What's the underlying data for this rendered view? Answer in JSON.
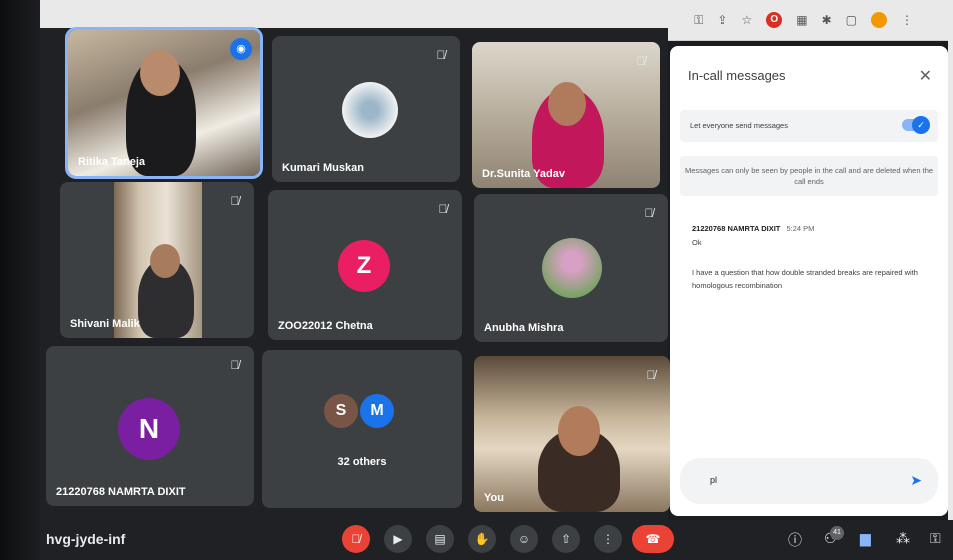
{
  "meeting_code": "hvg-jyde-inf",
  "participants": [
    {
      "name": "Ritika Taneja",
      "kind": "video",
      "speaking": true
    },
    {
      "name": "Kumari Muskan",
      "kind": "photo-avatar",
      "muted": true
    },
    {
      "name": "Dr.Sunita Yadav",
      "kind": "video",
      "muted": true
    },
    {
      "name": "Shivani Malik",
      "kind": "video",
      "muted": true
    },
    {
      "name": "ZOO22012 Chetna",
      "kind": "letter-avatar",
      "letter": "Z",
      "color": "#e91e63",
      "muted": true
    },
    {
      "name": "Anubha Mishra",
      "kind": "photo-avatar",
      "muted": true
    },
    {
      "name": "21220768 NAMRTA DIXIT",
      "kind": "letter-avatar",
      "letter": "N",
      "color": "#7b1fa2",
      "muted": true
    },
    {
      "name": "32 others",
      "kind": "group",
      "letters": [
        "S",
        "M"
      ],
      "colors": [
        "#795548",
        "#1a73e8"
      ]
    },
    {
      "name": "You",
      "kind": "video",
      "muted": true
    }
  ],
  "chat": {
    "title": "In-call messages",
    "toggle_label": "Let everyone send messages",
    "notice": "Messages can only be seen by people in the call and are deleted when the call ends",
    "messages": [
      {
        "sender": "21220768 NAMRTA DIXIT",
        "time": "5:24 PM",
        "lines": [
          "Ok",
          "I have a question that how double stranded breaks are repaired with homologous recombination"
        ]
      }
    ],
    "input_value": "pl"
  },
  "toolbar": {
    "participant_count": "41"
  },
  "colors": {
    "accent": "#1a73e8",
    "end_call": "#ea4335",
    "tile_bg": "#3c4043"
  }
}
